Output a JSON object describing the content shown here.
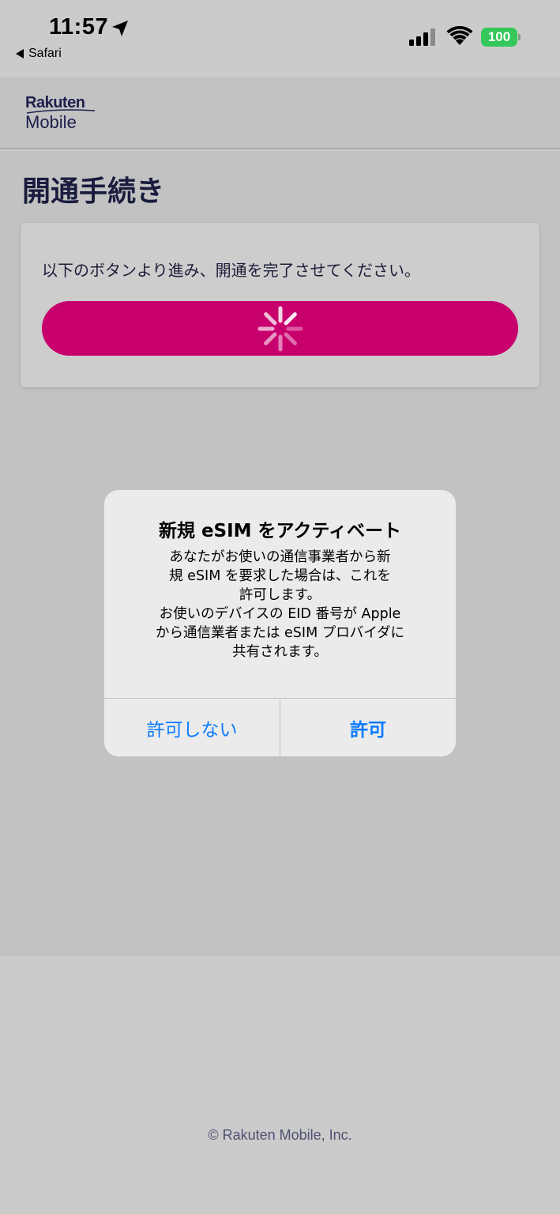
{
  "status_bar": {
    "time": "11:57",
    "back_app": "Safari",
    "battery": "100",
    "battery_color": "#34c759"
  },
  "header": {
    "logo_top": "Rakuten",
    "logo_bottom": "Mobile"
  },
  "main": {
    "page_title": "開通手続き",
    "card_text": "以下のボタンより進み、開通を完了させてください。",
    "button_color": "#c8006e"
  },
  "alert": {
    "title": "新規 eSIM をアクティベート",
    "message_lines": [
      "あなたがお使いの通信事業者から新",
      "規 eSIM を要求した場合は、これを",
      "許可します。",
      "お使いのデバイスの EID 番号が Apple",
      "から通信業者または eSIM プロバイダに",
      "共有されます。"
    ],
    "deny_label": "許可しない",
    "allow_label": "許可",
    "accent_color": "#0a7aff"
  },
  "footer": {
    "copyright": "© Rakuten Mobile, Inc."
  }
}
